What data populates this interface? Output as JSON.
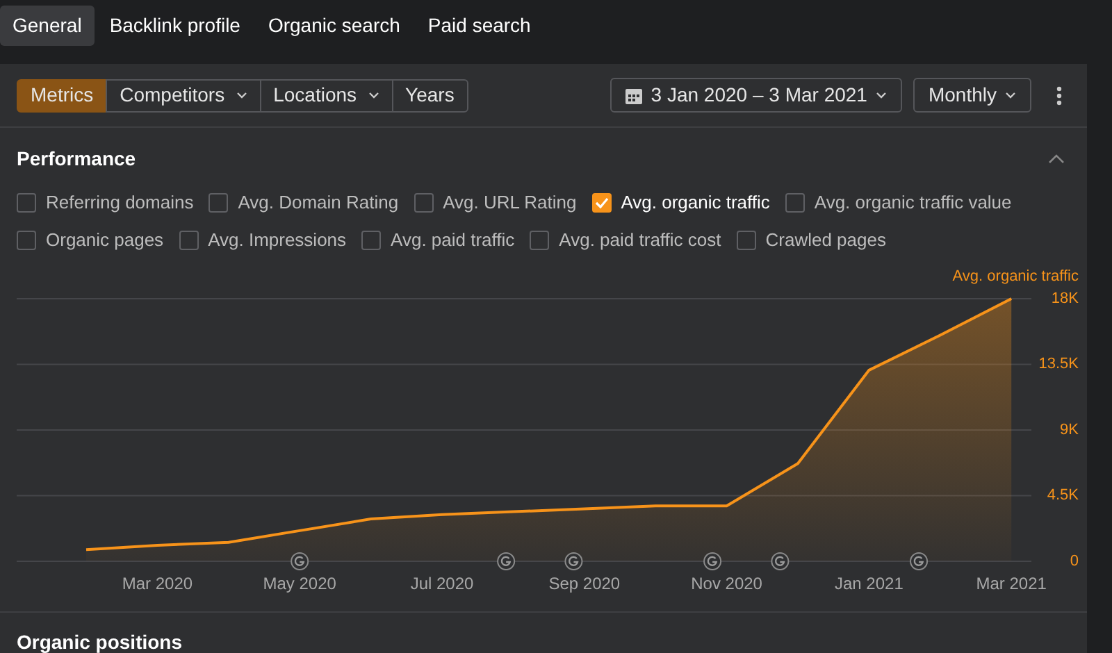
{
  "tabs": [
    {
      "label": "General",
      "selected": true
    },
    {
      "label": "Backlink profile",
      "selected": false
    },
    {
      "label": "Organic search",
      "selected": false
    },
    {
      "label": "Paid search",
      "selected": false
    }
  ],
  "modes": [
    {
      "label": "Metrics",
      "selected": true,
      "dropdown": false
    },
    {
      "label": "Competitors",
      "selected": false,
      "dropdown": true
    },
    {
      "label": "Locations",
      "selected": false,
      "dropdown": true
    },
    {
      "label": "Years",
      "selected": false,
      "dropdown": false
    }
  ],
  "date_range": "3 Jan 2020 – 3 Mar 2021",
  "interval": "Monthly",
  "performance": {
    "title": "Performance",
    "expanded": true,
    "metrics": [
      [
        {
          "label": "Referring domains",
          "checked": false
        },
        {
          "label": "Avg. Domain Rating",
          "checked": false
        },
        {
          "label": "Avg. URL Rating",
          "checked": false
        },
        {
          "label": "Avg. organic traffic",
          "checked": true
        },
        {
          "label": "Avg. organic traffic value",
          "checked": false
        }
      ],
      [
        {
          "label": "Organic pages",
          "checked": false
        },
        {
          "label": "Avg. Impressions",
          "checked": false
        },
        {
          "label": "Avg. paid traffic",
          "checked": false
        },
        {
          "label": "Avg. paid traffic cost",
          "checked": false
        },
        {
          "label": "Crawled pages",
          "checked": false
        }
      ]
    ],
    "chart_data": {
      "type": "area",
      "categories": [
        null,
        "Mar 2020",
        null,
        "May 2020",
        null,
        "Jul 2020",
        null,
        "Sep 2020",
        null,
        "Nov 2020",
        null,
        "Jan 2021",
        null,
        "Mar 2021"
      ],
      "series": [
        {
          "name": "Avg. organic traffic",
          "color": "#f7931a",
          "values": [
            800,
            1100,
            1300,
            2100,
            2900,
            3200,
            3400,
            3600,
            3800,
            3800,
            6700,
            13100,
            15500,
            18000
          ]
        }
      ],
      "ylim": [
        0,
        18000
      ],
      "grid": true,
      "yticks": [
        {
          "value": 0,
          "label": "0"
        },
        {
          "value": 4500,
          "label": "4.5K"
        },
        {
          "value": 9000,
          "label": "9K"
        },
        {
          "value": 13500,
          "label": "13.5K"
        },
        {
          "value": 18000,
          "label": "18K"
        }
      ]
    }
  },
  "next_section": {
    "title": "Organic positions"
  }
}
